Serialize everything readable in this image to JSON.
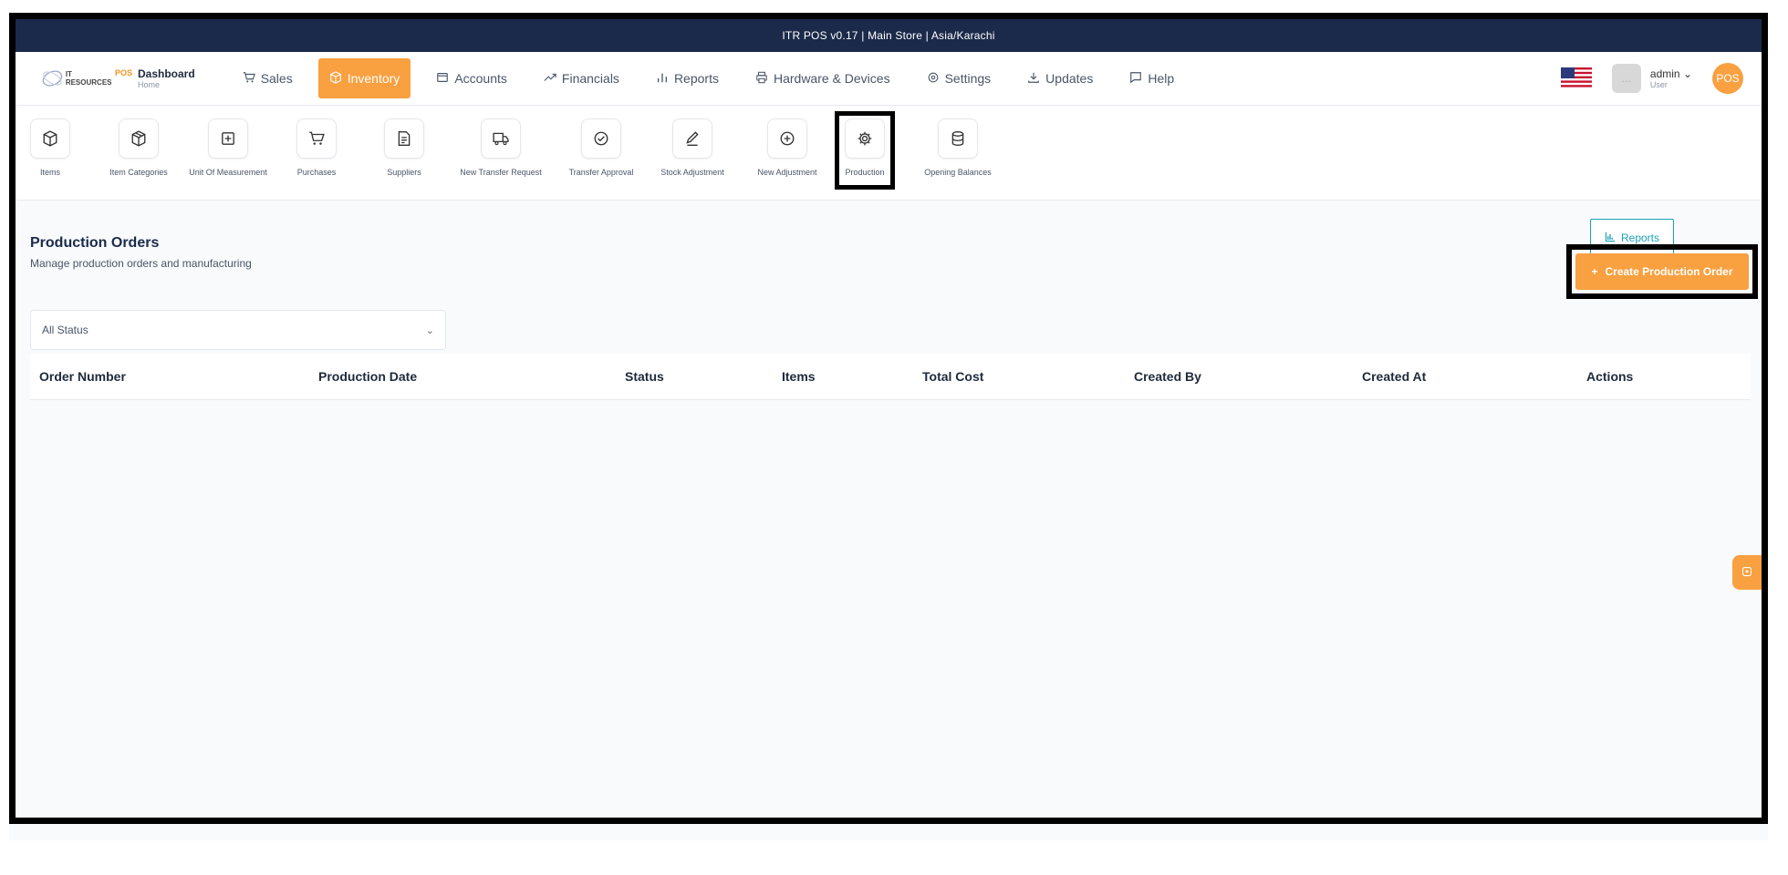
{
  "topbar": {
    "text": "ITR POS v0.17  |  Main Store  |  Asia/Karachi"
  },
  "logo": {
    "brand": "IT RESOURCES",
    "pos": "POS"
  },
  "dashboard": {
    "title": "Dashboard",
    "subtitle": "Home"
  },
  "mainnav": [
    {
      "label": "Sales",
      "icon": "cart-icon",
      "active": false
    },
    {
      "label": "Inventory",
      "icon": "box-icon",
      "active": true
    },
    {
      "label": "Accounts",
      "icon": "wallet-icon",
      "active": false
    },
    {
      "label": "Financials",
      "icon": "trend-icon",
      "active": false
    },
    {
      "label": "Reports",
      "icon": "bar-chart-icon",
      "active": false
    },
    {
      "label": "Hardware & Devices",
      "icon": "printer-icon",
      "active": false
    },
    {
      "label": "Settings",
      "icon": "gear-icon",
      "active": false
    },
    {
      "label": "Updates",
      "icon": "download-icon",
      "active": false
    },
    {
      "label": "Help",
      "icon": "chat-icon",
      "active": false
    }
  ],
  "user": {
    "name": "admin",
    "role": "User",
    "badge": "POS"
  },
  "subnav": [
    {
      "label": "Items",
      "icon": "box-icon"
    },
    {
      "label": "Item Categories",
      "icon": "boxes-icon"
    },
    {
      "label": "Unit Of Measurement",
      "icon": "plus-square-icon"
    },
    {
      "label": "Purchases",
      "icon": "cart-icon"
    },
    {
      "label": "Suppliers",
      "icon": "document-icon"
    },
    {
      "label": "New Transfer Request",
      "icon": "truck-icon"
    },
    {
      "label": "Transfer Approval",
      "icon": "check-circle-icon"
    },
    {
      "label": "Stock Adjustment",
      "icon": "pen-icon"
    },
    {
      "label": "New Adjustment",
      "icon": "plus-circle-icon"
    },
    {
      "label": "Production",
      "icon": "gear-icon"
    },
    {
      "label": "Opening Balances",
      "icon": "database-icon"
    }
  ],
  "page": {
    "title": "Production Orders",
    "subtitle": "Manage production orders and manufacturing",
    "reports_label": "Reports",
    "create_label": "Create Production Order",
    "status_filter": "All Status"
  },
  "table": {
    "columns": [
      "Order Number",
      "Production Date",
      "Status",
      "Items",
      "Total Cost",
      "Created By",
      "Created At",
      "Actions"
    ]
  },
  "colors": {
    "accent": "#f9a040",
    "topbar": "#1b2a4a",
    "teal": "#18a2b8"
  }
}
